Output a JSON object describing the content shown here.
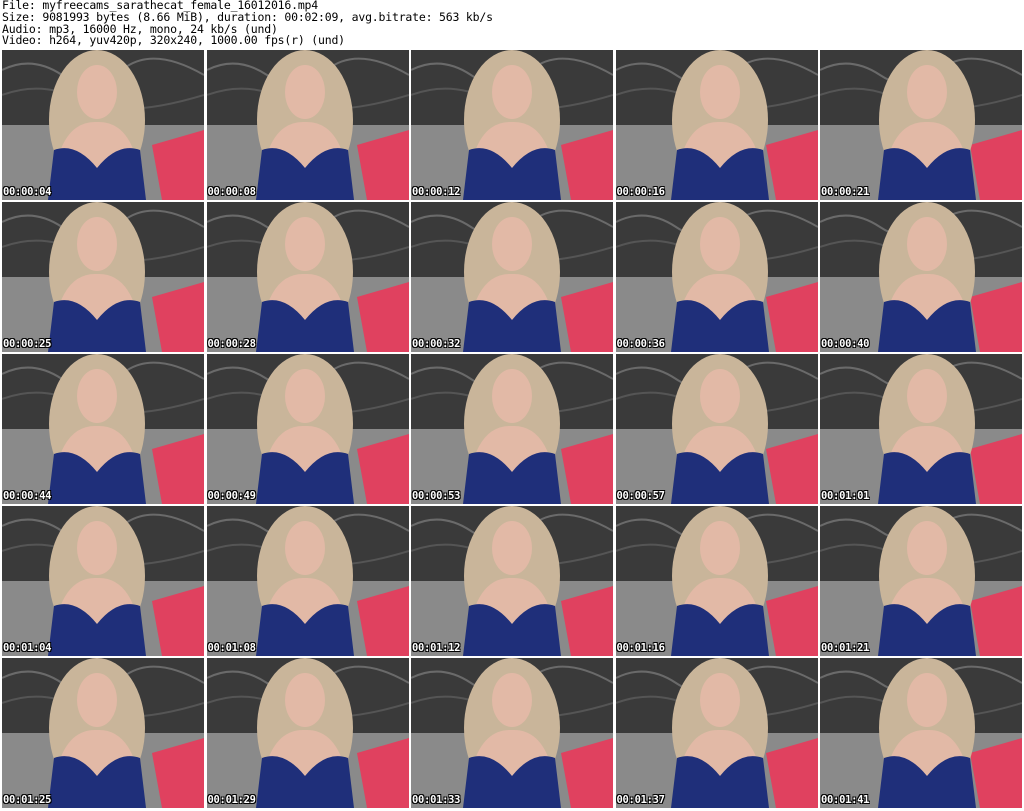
{
  "header": {
    "file_line": "File: myfreecams_sarathecat_female_16012016.mp4",
    "size_line": "Size: 9081993 bytes (8.66 MiB), duration: 00:02:09, avg.bitrate: 563 kb/s",
    "audio_line": "Audio: mp3, 16000 Hz, mono, 24 kb/s (und)",
    "video_line": "Video: h264, yuv420p, 320x240, 1000.00 fps(r) (und)"
  },
  "colors": {
    "wall": "#3a3a3a",
    "sofa": "#8a8a8a",
    "pillow": "#e0415f",
    "hair": "#c9b59a",
    "skin": "#e2b9a6",
    "top": "#1f2f7a"
  },
  "thumbnails": [
    {
      "timestamp": "00:00:04"
    },
    {
      "timestamp": "00:00:08"
    },
    {
      "timestamp": "00:00:12"
    },
    {
      "timestamp": "00:00:16"
    },
    {
      "timestamp": "00:00:21"
    },
    {
      "timestamp": "00:00:25"
    },
    {
      "timestamp": "00:00:28"
    },
    {
      "timestamp": "00:00:32"
    },
    {
      "timestamp": "00:00:36"
    },
    {
      "timestamp": "00:00:40"
    },
    {
      "timestamp": "00:00:44"
    },
    {
      "timestamp": "00:00:49"
    },
    {
      "timestamp": "00:00:53"
    },
    {
      "timestamp": "00:00:57"
    },
    {
      "timestamp": "00:01:01"
    },
    {
      "timestamp": "00:01:04"
    },
    {
      "timestamp": "00:01:08"
    },
    {
      "timestamp": "00:01:12"
    },
    {
      "timestamp": "00:01:16"
    },
    {
      "timestamp": "00:01:21"
    },
    {
      "timestamp": "00:01:25"
    },
    {
      "timestamp": "00:01:29"
    },
    {
      "timestamp": "00:01:33"
    },
    {
      "timestamp": "00:01:37"
    },
    {
      "timestamp": "00:01:41"
    }
  ]
}
